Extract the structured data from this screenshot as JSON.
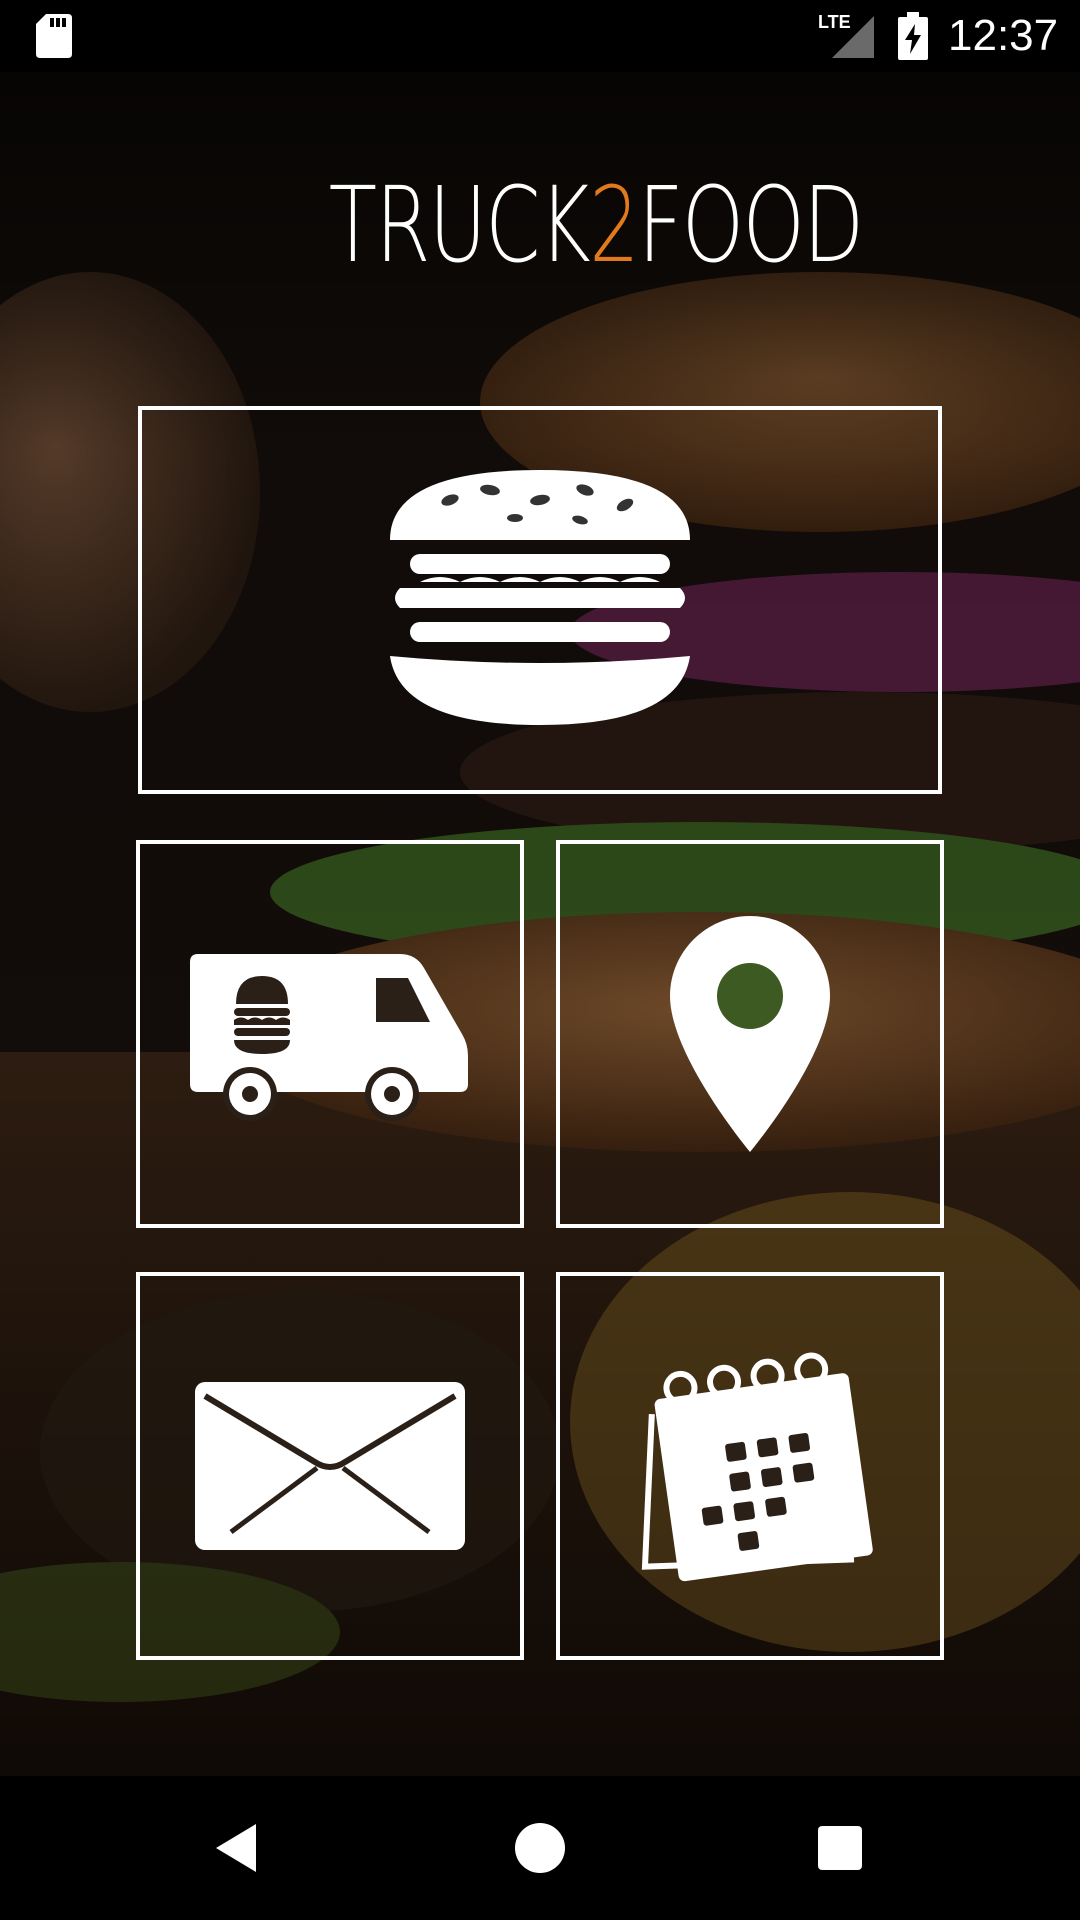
{
  "status_bar": {
    "time": "12:37",
    "network": "LTE",
    "icons": [
      "sd-card-icon",
      "lte-signal-icon",
      "battery-charging-icon"
    ]
  },
  "app": {
    "logo": {
      "part1": "TRUCK",
      "part2": "2",
      "part3": "FOOD"
    },
    "accent_color": "#e07a1d",
    "tiles": [
      {
        "name": "menu",
        "icon": "burger-icon"
      },
      {
        "name": "food-truck",
        "icon": "food-truck-icon"
      },
      {
        "name": "location",
        "icon": "map-pin-icon"
      },
      {
        "name": "contact",
        "icon": "envelope-icon"
      },
      {
        "name": "calendar",
        "icon": "calendar-icon"
      }
    ]
  },
  "nav_bar": {
    "buttons": [
      "back-icon",
      "home-icon",
      "recent-apps-icon"
    ]
  }
}
